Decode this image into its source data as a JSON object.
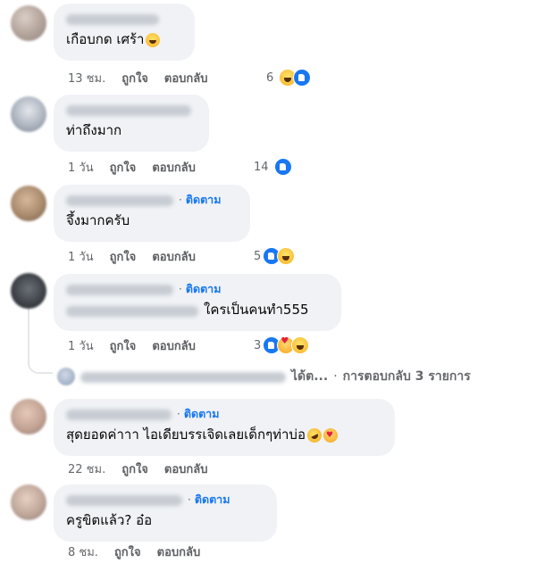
{
  "comments": [
    {
      "text": "เกือบกด เศร้า",
      "text_emoji": "haha-icon",
      "follow_label": "",
      "actions": {
        "time": "13 ชม.",
        "like": "ถูกใจ",
        "reply": "ตอบกลับ"
      },
      "reaction_count": "6",
      "reactions": [
        "haha-icon",
        "like-icon"
      ]
    },
    {
      "text": "ท่าถึงมาก",
      "follow_label": "",
      "actions": {
        "time": "1 วัน",
        "like": "ถูกใจ",
        "reply": "ตอบกลับ"
      },
      "reaction_count": "14",
      "reactions": [
        "like-icon"
      ]
    },
    {
      "text": "จึ้งมากครับ",
      "follow_label": "ติดตาม",
      "actions": {
        "time": "1 วัน",
        "like": "ถูกใจ",
        "reply": "ตอบกลับ"
      },
      "reaction_count": "5",
      "reactions": [
        "like-icon",
        "haha-icon"
      ]
    },
    {
      "text": "ใครเป็นคนทำ555",
      "follow_label": "ติดตาม",
      "actions": {
        "time": "1 วัน",
        "like": "ถูกใจ",
        "reply": "ตอบกลับ"
      },
      "reaction_count": "3",
      "reactions": [
        "like-icon",
        "love-icon",
        "haha-icon"
      ],
      "replies": {
        "preview_suffix": "ได้ต...",
        "separator": "·",
        "summary": "การตอบกลับ 3 รายการ"
      }
    },
    {
      "text": "สุดยอดค่าาา ไอเดียบรรเจิดเลยเด็กๆท่าบ่อ",
      "text_emoji": [
        "rofl-icon",
        "kiss-icon"
      ],
      "follow_label": "ติดตาม",
      "actions": {
        "time": "22 ชม.",
        "like": "ถูกใจ",
        "reply": "ตอบกลับ"
      }
    },
    {
      "text": "ครูขิตแล้ว? อ๋อ",
      "follow_label": "ติดตาม",
      "actions": {
        "time": "8 ชม.",
        "like": "ถูกใจ",
        "reply": "ตอบกลับ"
      }
    }
  ],
  "colors": {
    "bubble": "#f0f2f5",
    "follow": "#1877f2",
    "meta": "#65676b",
    "like": "#1877f2"
  }
}
